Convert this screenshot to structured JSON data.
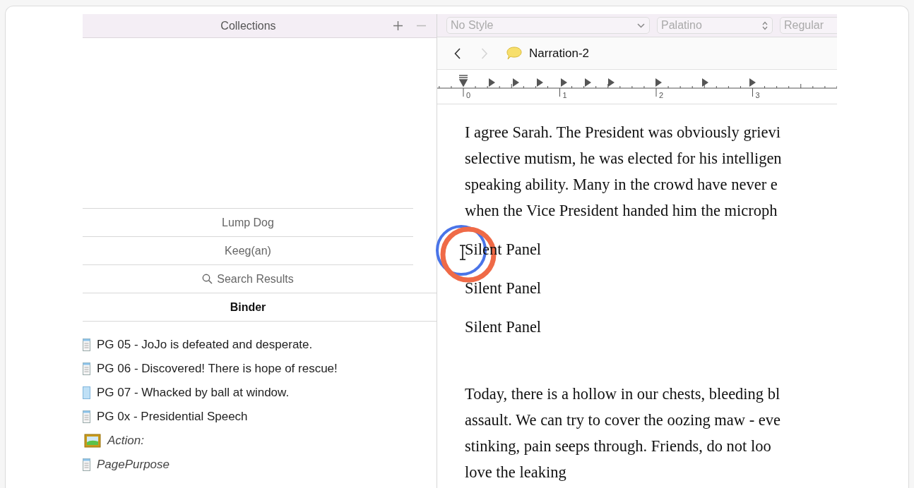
{
  "collections": {
    "title": "Collections"
  },
  "collection_tabs": [
    {
      "label": "Lump Dog",
      "kind": "plain",
      "selected": false
    },
    {
      "label": "Keeg(an)",
      "kind": "plain",
      "selected": false
    },
    {
      "label": "Search Results",
      "kind": "search",
      "selected": false
    },
    {
      "label": "Binder",
      "kind": "plain",
      "selected": true
    }
  ],
  "binder_items": [
    {
      "label": "PG 05 -  JoJo is defeated and desperate.",
      "kind": "text",
      "italic": false
    },
    {
      "label": "PG 06 - Discovered! There is hope of rescue!",
      "kind": "text",
      "italic": false
    },
    {
      "label": "PG 07 - Whacked by ball at window.",
      "kind": "empty",
      "italic": false
    },
    {
      "label": "PG 0x - Presidential Speech",
      "kind": "text",
      "italic": false
    },
    {
      "label": "Action:",
      "kind": "image",
      "italic": true
    },
    {
      "label": "PagePurpose",
      "kind": "text",
      "italic": true
    }
  ],
  "format_bar": [
    {
      "value": "No Style",
      "kind": "dropdown"
    },
    {
      "value": "Palatino",
      "kind": "stepper"
    },
    {
      "value": "Regular",
      "kind": "plain"
    }
  ],
  "nav": [
    {
      "kind": "back",
      "disabled": false
    },
    {
      "kind": "forward",
      "disabled": true
    }
  ],
  "header": {
    "title": "Narration-2"
  },
  "ruler": {
    "labels": [
      "0",
      "1",
      "2",
      "3"
    ]
  },
  "document": [
    {
      "kind": "paragraph",
      "lines": [
        "I agree Sarah. The President was obviously grievi",
        "selective mutism, he was elected for his intelligen",
        "speaking ability. Many in the crowd have never e",
        "when the Vice President handed him the microph"
      ]
    },
    {
      "kind": "line",
      "lines": [
        "Silent Panel"
      ]
    },
    {
      "kind": "line",
      "lines": [
        "Silent Panel"
      ]
    },
    {
      "kind": "line",
      "lines": [
        "Silent Panel"
      ]
    },
    {
      "kind": "paragraph",
      "lines": [
        "Today, there is a hollow in our chests, bleeding bl",
        "assault. We can try to cover the oozing maw - eve",
        "stinking, pain seeps through.  Friends, do not loo",
        "love the leaking"
      ]
    }
  ]
}
